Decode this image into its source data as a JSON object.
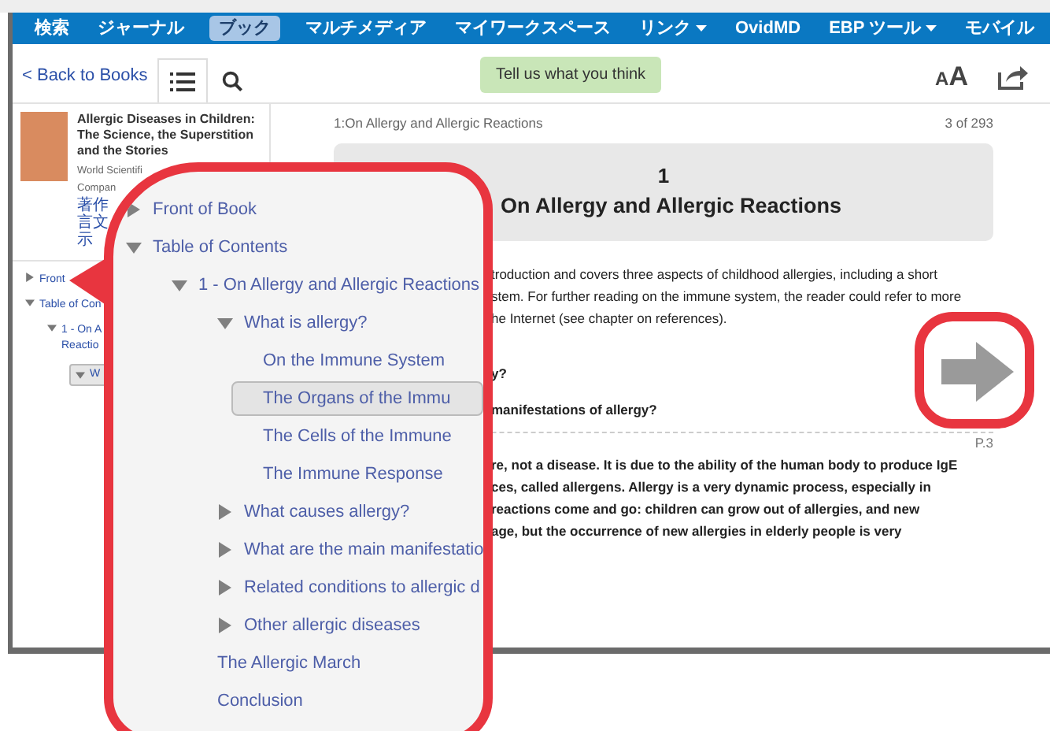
{
  "nav": [
    {
      "label": "検索",
      "selected": false,
      "dropdown": false
    },
    {
      "label": "ジャーナル",
      "selected": false,
      "dropdown": false
    },
    {
      "label": "ブック",
      "selected": true,
      "dropdown": false
    },
    {
      "label": "マルチメディア",
      "selected": false,
      "dropdown": false
    },
    {
      "label": "マイワークスペース",
      "selected": false,
      "dropdown": false
    },
    {
      "label": "リンク",
      "selected": false,
      "dropdown": true
    },
    {
      "label": "OvidMD",
      "selected": false,
      "dropdown": false
    },
    {
      "label": "EBP ツール",
      "selected": false,
      "dropdown": true
    },
    {
      "label": "モバイル",
      "selected": false,
      "dropdown": false
    }
  ],
  "toolbar": {
    "back_link": "< Back to Books",
    "tabs": [
      {
        "kind": "toc",
        "selected": true
      },
      {
        "kind": "search",
        "selected": false
      }
    ],
    "feedback_button": "Tell us what you think",
    "font_size": {
      "small": "A",
      "large": "A"
    }
  },
  "book": {
    "title": "Allergic Diseases in Children: The Science, the Superstition and the Stories",
    "publisher_lines": [
      "World Scientifi",
      "Compan"
    ],
    "links": [
      "著作",
      "言文",
      "示"
    ]
  },
  "sidebar_toc": [
    {
      "lines": [
        "Front"
      ],
      "expanded": false,
      "selected": false
    },
    {
      "lines": [
        "Table of Con"
      ],
      "expanded": true,
      "selected": false,
      "children": [
        {
          "lines": [
            "1 - On A",
            "Reactio"
          ],
          "expanded": true,
          "selected": false,
          "children": [
            {
              "lines": [
                "W"
              ],
              "expanded": true,
              "selected": true
            }
          ]
        }
      ]
    }
  ],
  "content": {
    "breadcrumb": "1:On Allergy and Allergic Reactions",
    "page_count": "3 of 293",
    "chapter_number": "1",
    "chapter_title": "On Allergy and Allergic Reactions",
    "intro_lines": [
      "troduction and covers three aspects of childhood allergies, including a short",
      "stem. For further reading on the immune system, the reader could refer to more",
      "he Internet (see chapter on references)."
    ],
    "questions": [
      "y?",
      "manifestations of allergy?"
    ],
    "page_label": "P.3",
    "body_lines": [
      "re, not a disease. It is due to the ability of the human body to produce IgE",
      "ces, called allergens. Allergy is a very dynamic process, especially in",
      "reactions come and go: children can grow out of allergies, and new",
      "age, but the occurrence of new allergies in elderly people is very"
    ]
  },
  "callout_toc": [
    {
      "label": "Front of Book",
      "expanded": false,
      "selected": false
    },
    {
      "label": "Table of Contents",
      "expanded": true,
      "selected": false,
      "children": [
        {
          "label": "1 - On Allergy and Allergic Reactions",
          "expanded": true,
          "selected": false,
          "children": [
            {
              "label": "What is allergy?",
              "expanded": true,
              "selected": false,
              "children": [
                {
                  "label": "On the Immune System",
                  "selected": false
                },
                {
                  "label": "The Organs of the Immu",
                  "selected": true
                },
                {
                  "label": "The Cells of the Immune",
                  "selected": false
                },
                {
                  "label": "The Immune Response",
                  "selected": false
                }
              ]
            },
            {
              "label": "What causes allergy?",
              "expanded": false,
              "selected": false
            },
            {
              "label": "What are the main manifestatio",
              "expanded": false,
              "selected": false
            },
            {
              "label": "Related conditions to allergic d",
              "expanded": false,
              "selected": false
            },
            {
              "label": "Other allergic diseases",
              "expanded": false,
              "selected": false
            },
            {
              "label": "The Allergic March",
              "selected": false
            },
            {
              "label": "Conclusion",
              "selected": false
            }
          ]
        }
      ]
    }
  ]
}
